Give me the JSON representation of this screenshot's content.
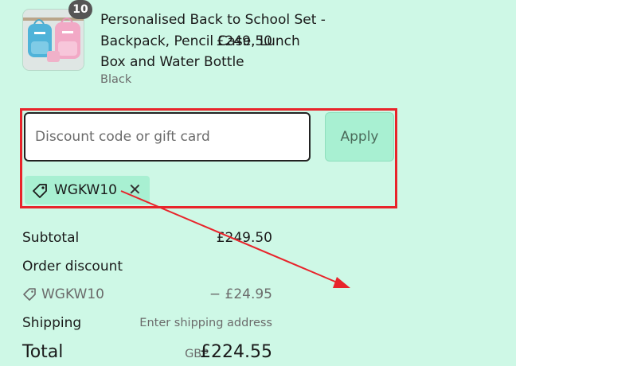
{
  "product": {
    "quantity_badge": "10",
    "title": "Personalised Back to School Set - Backpack, Pencil Case, Lunch Box and Water Bottle",
    "variant": "Black",
    "price": "£249.50"
  },
  "discount": {
    "input_placeholder": "Discount code or gift card",
    "apply_label": "Apply",
    "applied_code": "WGKW10"
  },
  "summary": {
    "subtotal_label": "Subtotal",
    "subtotal_value": "£249.50",
    "order_discount_label": "Order discount",
    "discount_code": "WGKW10",
    "discount_value": "− £24.95",
    "shipping_label": "Shipping",
    "shipping_value": "Enter shipping address",
    "total_label": "Total",
    "total_currency": "GBP",
    "total_value": "£224.55"
  },
  "colors": {
    "panel_bg": "#cef8e6",
    "apply_bg": "#a8f0d2",
    "annotation_red": "#e8242b"
  },
  "icons": {
    "tag": "tag-icon",
    "close": "close-icon"
  }
}
